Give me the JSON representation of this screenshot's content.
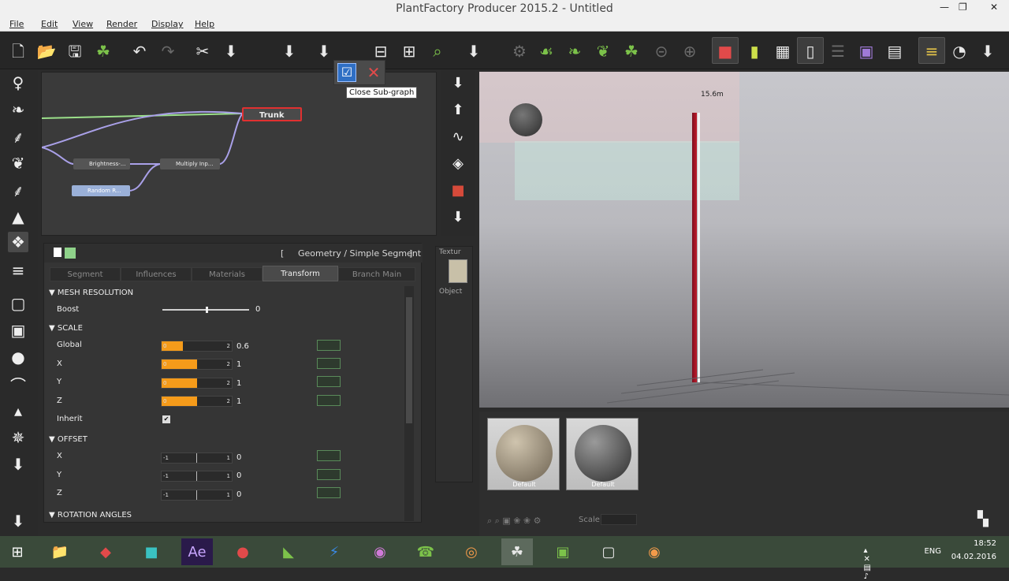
{
  "window": {
    "title": "PlantFactory Producer 2015.2 - Untitled",
    "minimize": "—",
    "restore": "❐",
    "close": "✕"
  },
  "menu": [
    "File",
    "Edit",
    "View",
    "Render",
    "Display",
    "Help"
  ],
  "graph": {
    "trunk_node": "Trunk",
    "node_brightness": "Brightness-...",
    "node_multiply": "Multiply Inp...",
    "node_random": "Random R...",
    "tooltip": "Close Sub-graph"
  },
  "properties": {
    "path": "Geometry / Simple Segment",
    "bracket_open": "[",
    "bracket_close": "]",
    "tabs": [
      "Segment",
      "Influences",
      "Materials",
      "Transform",
      "Branch Main"
    ],
    "active_tab": "Transform",
    "mesh_resolution": {
      "title": "MESH RESOLUTION",
      "boost_label": "Boost",
      "boost_value": "0",
      "boost_level": 0.5
    },
    "scale": {
      "title": "SCALE",
      "rows": [
        {
          "label": "Global",
          "min": "0",
          "max": "2",
          "value": "0.6",
          "fill": 0.3
        },
        {
          "label": "X",
          "min": "0",
          "max": "2",
          "value": "1",
          "fill": 0.5
        },
        {
          "label": "Y",
          "min": "0",
          "max": "2",
          "value": "1",
          "fill": 0.5
        },
        {
          "label": "Z",
          "min": "0",
          "max": "2",
          "value": "1",
          "fill": 0.5
        }
      ],
      "inherit_label": "Inherit",
      "inherit_checked": "✔"
    },
    "offset": {
      "title": "OFFSET",
      "rows": [
        {
          "label": "X",
          "min": "-1",
          "max": "1",
          "value": "0"
        },
        {
          "label": "Y",
          "min": "-1",
          "max": "1",
          "value": "0"
        },
        {
          "label": "Z",
          "min": "-1",
          "max": "1",
          "value": "0"
        }
      ]
    },
    "rotation": {
      "title": "ROTATION ANGLES"
    }
  },
  "texture_panel": {
    "texture_label": "Textur",
    "object_label": "Object"
  },
  "viewport": {
    "height_label": "15.6m"
  },
  "materials": {
    "items": [
      {
        "label": "Default"
      },
      {
        "label": "Default"
      }
    ],
    "scale_label": "Scale"
  },
  "tray": {
    "lang": "ENG",
    "time": "18:52",
    "date": "04.02.2016"
  },
  "colors": {
    "accent_orange": "#f59b1a",
    "trunk_node_border": "#e03030",
    "link_green": "#9be08a",
    "link_purple": "#a9a0e8"
  }
}
